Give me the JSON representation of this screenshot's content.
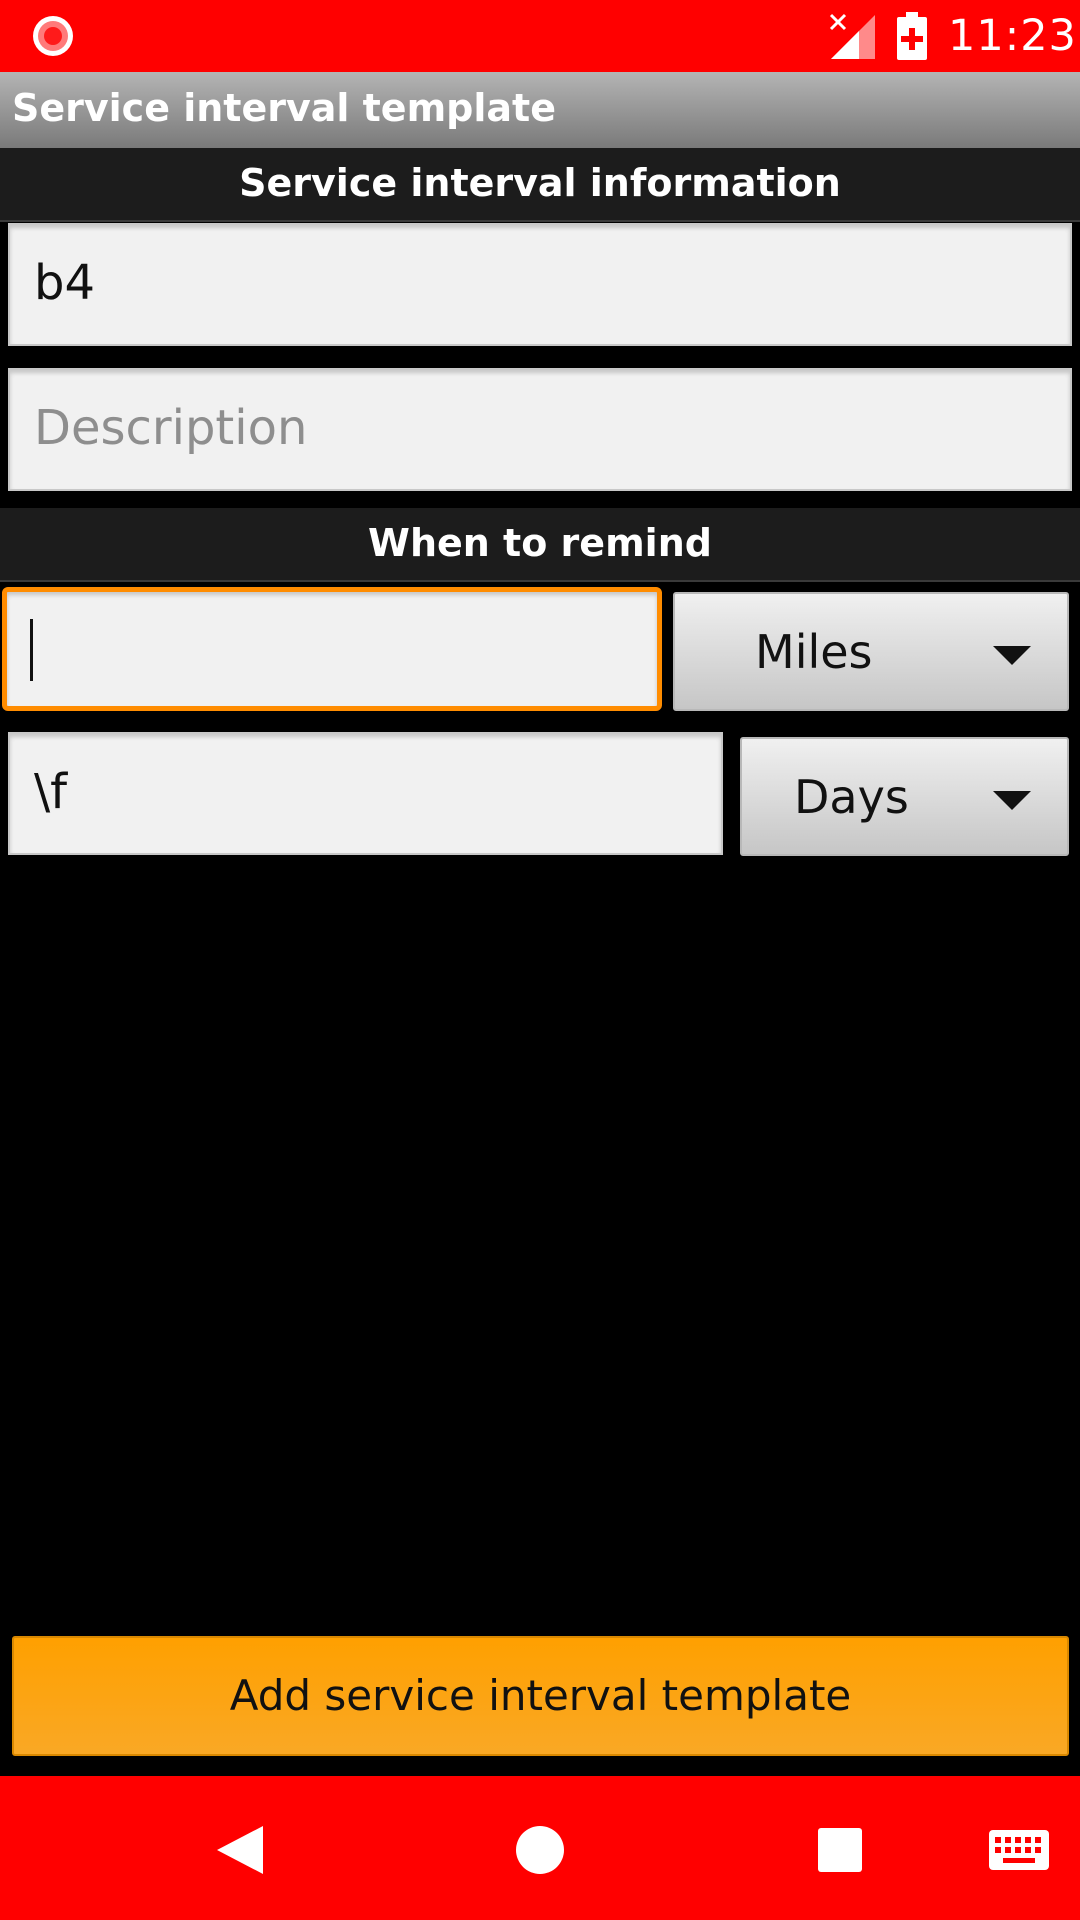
{
  "status_bar": {
    "time": "11:23",
    "left_icon": "screen-record-icon",
    "signal_icon": "no-signal-icon",
    "battery_icon": "battery-charging-icon"
  },
  "title_bar": {
    "title": "Service interval template"
  },
  "info_section": {
    "header": "Service interval information",
    "name_value": "b4",
    "description_placeholder": "Description"
  },
  "remind_section": {
    "header": "When to remind",
    "distance_value": "",
    "distance_unit": "Miles",
    "time_value": "\\f",
    "time_unit": "Days"
  },
  "actions": {
    "add_label": "Add service interval template"
  },
  "nav_bar": {
    "back_icon": "back-icon",
    "home_icon": "home-icon",
    "recents_icon": "recents-icon",
    "keyboard_icon": "keyboard-icon"
  },
  "colors": {
    "system_bars": "#ff0000",
    "accent": "#ff8c00",
    "button": "#ffa000"
  }
}
